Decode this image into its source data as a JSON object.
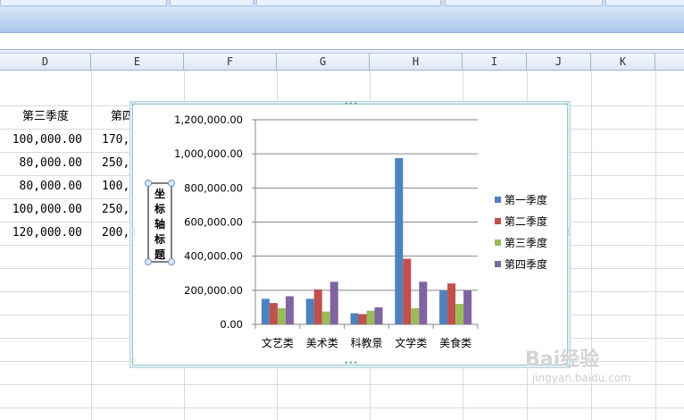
{
  "columns": [
    "D",
    "E",
    "F",
    "G",
    "H",
    "I",
    "J",
    "K"
  ],
  "cells": {
    "header_d": "第三季度",
    "header_e": "第四",
    "d_values": [
      "100,000.00",
      "80,000.00",
      "80,000.00",
      "100,000.00",
      "120,000.00"
    ],
    "e_values": [
      "170,0",
      "250,0",
      "100,0",
      "250,0",
      "200,0"
    ]
  },
  "chart": {
    "axis_title": "坐标轴标题",
    "axis_title_chars": [
      "坐",
      "标",
      "轴",
      "标",
      "题"
    ],
    "colors": {
      "q1": "#4f81bd",
      "q2": "#c0504d",
      "q3": "#9bbb59",
      "q4": "#8064a2"
    }
  },
  "chart_data": {
    "type": "bar",
    "categories": [
      "文艺类",
      "美术类",
      "科教景",
      "文学类",
      "美食类"
    ],
    "series": [
      {
        "name": "第一季度",
        "values": [
          150000,
          150000,
          65000,
          975000,
          200000
        ]
      },
      {
        "name": "第二季度",
        "values": [
          125000,
          205000,
          60000,
          385000,
          240000
        ]
      },
      {
        "name": "第三季度",
        "values": [
          95000,
          75000,
          80000,
          95000,
          120000
        ]
      },
      {
        "name": "第四季度",
        "values": [
          165000,
          250000,
          100000,
          250000,
          200000
        ]
      }
    ],
    "ylim": [
      0,
      1200000
    ],
    "yticks": [
      "0.00",
      "200,000.00",
      "400,000.00",
      "600,000.00",
      "800,000.00",
      "1,000,000.00",
      "1,200,000.00"
    ],
    "ylabel": "坐标轴标题",
    "legend": "right",
    "grid": true
  },
  "watermark": {
    "title": "Bai经验",
    "url": "jingyan.baidu.com"
  }
}
